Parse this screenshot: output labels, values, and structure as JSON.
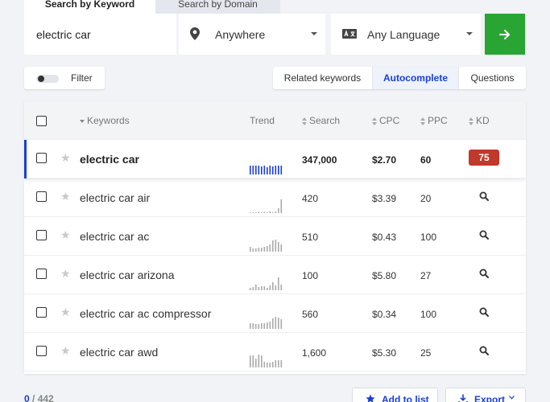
{
  "tabs": {
    "by_keyword": "Search by Keyword",
    "by_domain": "Search by Domain"
  },
  "search": {
    "keyword_value": "electric car",
    "location": "Anywhere",
    "language": "Any Language"
  },
  "filter": {
    "label": "Filter"
  },
  "modes": {
    "related": "Related keywords",
    "autocomplete": "Autocomplete",
    "questions": "Questions"
  },
  "table": {
    "headers": {
      "keywords": "Keywords",
      "trend": "Trend",
      "search": "Search",
      "cpc": "CPC",
      "ppc": "PPC",
      "kd": "KD"
    },
    "rows": [
      {
        "keyword": "electric car",
        "search": "347,000",
        "cpc": "$2.70",
        "ppc": "60",
        "kd": "75",
        "trend": [
          0.55,
          0.55,
          0.55,
          0.55,
          0.5,
          0.55,
          0.45,
          0.55,
          0.5,
          0.55,
          0.55,
          0.55
        ]
      },
      {
        "keyword": "electric car air",
        "search": "420",
        "cpc": "$3.39",
        "ppc": "20",
        "kd": "",
        "trend": [
          0.05,
          0.05,
          0.05,
          0.08,
          0.05,
          0.08,
          0.05,
          0.1,
          0.05,
          0.1,
          0.3,
          0.85
        ]
      },
      {
        "keyword": "electric car ac",
        "search": "510",
        "cpc": "$0.43",
        "ppc": "100",
        "kd": "",
        "trend": [
          0.3,
          0.2,
          0.2,
          0.25,
          0.25,
          0.3,
          0.35,
          0.45,
          0.7,
          0.75,
          0.6,
          0.45
        ]
      },
      {
        "keyword": "electric car arizona",
        "search": "100",
        "cpc": "$5.80",
        "ppc": "27",
        "kd": "",
        "trend": [
          0.15,
          0.2,
          0.35,
          0.2,
          0.25,
          0.25,
          0.15,
          0.3,
          0.5,
          0.3,
          0.8,
          0.35
        ]
      },
      {
        "keyword": "electric car ac compressor",
        "search": "560",
        "cpc": "$0.34",
        "ppc": "100",
        "kd": "",
        "trend": [
          0.35,
          0.35,
          0.3,
          0.3,
          0.35,
          0.35,
          0.4,
          0.45,
          0.65,
          0.75,
          0.7,
          0.6
        ]
      },
      {
        "keyword": "electric car awd",
        "search": "1,600",
        "cpc": "$5.30",
        "ppc": "25",
        "kd": "",
        "trend": [
          0.75,
          0.75,
          0.55,
          0.8,
          0.75,
          0.35,
          0.3,
          0.3,
          0.35,
          0.45,
          0.45,
          0.45
        ]
      }
    ]
  },
  "footer": {
    "selected": "0",
    "total": "/ 442",
    "add_to_list": "Add to list",
    "export": "Export"
  },
  "colors": {
    "accent_blue": "#1a3fd4",
    "go_green": "#29a534",
    "kd_hard": "#c0392b",
    "trend_first": "#1a3fd4",
    "trend_default": "#aaaaaa"
  },
  "icons": {
    "location": "map-pin-icon",
    "language": "translate-icon",
    "go": "arrow-right-icon",
    "star": "star-icon",
    "kd_unknown": "search-icon",
    "add": "star-icon",
    "export": "download-icon"
  }
}
